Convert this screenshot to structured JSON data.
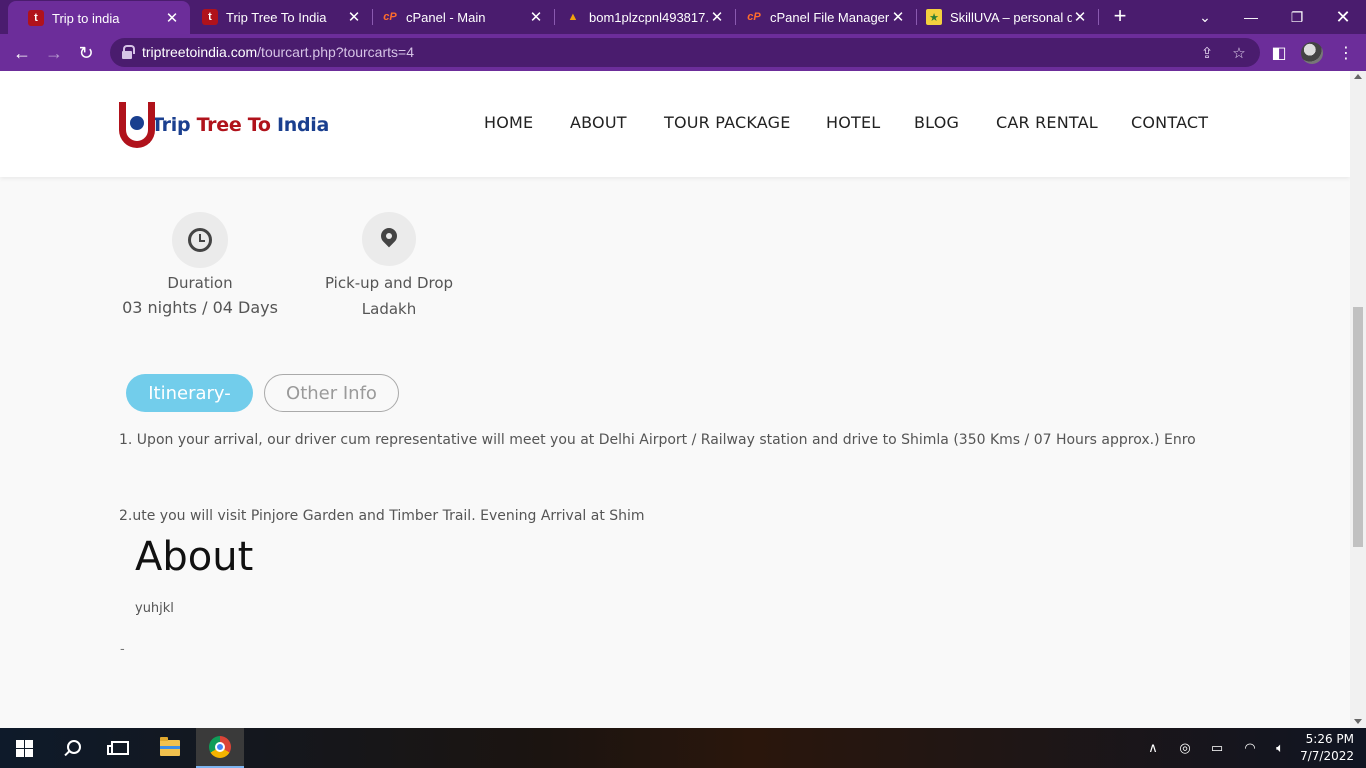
{
  "browser": {
    "tabs": [
      {
        "title": "Trip to india",
        "icon": "tti-icon",
        "active": true
      },
      {
        "title": "Trip Tree To India",
        "icon": "tti-icon",
        "active": false
      },
      {
        "title": "cPanel - Main",
        "icon": "cpanel-icon",
        "active": false
      },
      {
        "title": "bom1plzcpnl493817.p",
        "icon": "server-icon",
        "active": false
      },
      {
        "title": "cPanel File Manager v",
        "icon": "cpanel-icon",
        "active": false
      },
      {
        "title": "SkillUVA – personal de",
        "icon": "skilluva-icon",
        "active": false
      }
    ],
    "url_host": "triptreetoindia.com",
    "url_path": "/tourcart.php?tourcarts=4"
  },
  "site": {
    "logo": {
      "word1": "Trip",
      "word2": "Tree",
      "word3": "To",
      "word4": "India"
    },
    "nav": [
      "HOME",
      "ABOUT",
      "TOUR PACKAGE",
      "HOTEL",
      "BLOG",
      "CAR RENTAL",
      "CONTACT"
    ],
    "features": [
      {
        "label": "Duration",
        "value": "03 nights / 04 Days",
        "icon": "clock-icon"
      },
      {
        "label": "Pick-up and Drop",
        "value": "Ladakh",
        "icon": "map-pin-icon"
      }
    ],
    "tabs": {
      "itinerary": "Itinerary-",
      "other": "Other Info"
    },
    "itinerary": [
      "1. Upon your arrival, our driver cum representative will meet you at Delhi Airport / Railway station and drive to Shimla (350 Kms / 07 Hours approx.) Enro",
      "2.ute you will visit Pinjore Garden and Timber Trail. Evening Arrival at Shim"
    ],
    "about_title": "About",
    "about_text": "yuhjkl",
    "dash": "-"
  },
  "taskbar": {
    "time": "5:26 PM",
    "date": "7/7/2022"
  }
}
